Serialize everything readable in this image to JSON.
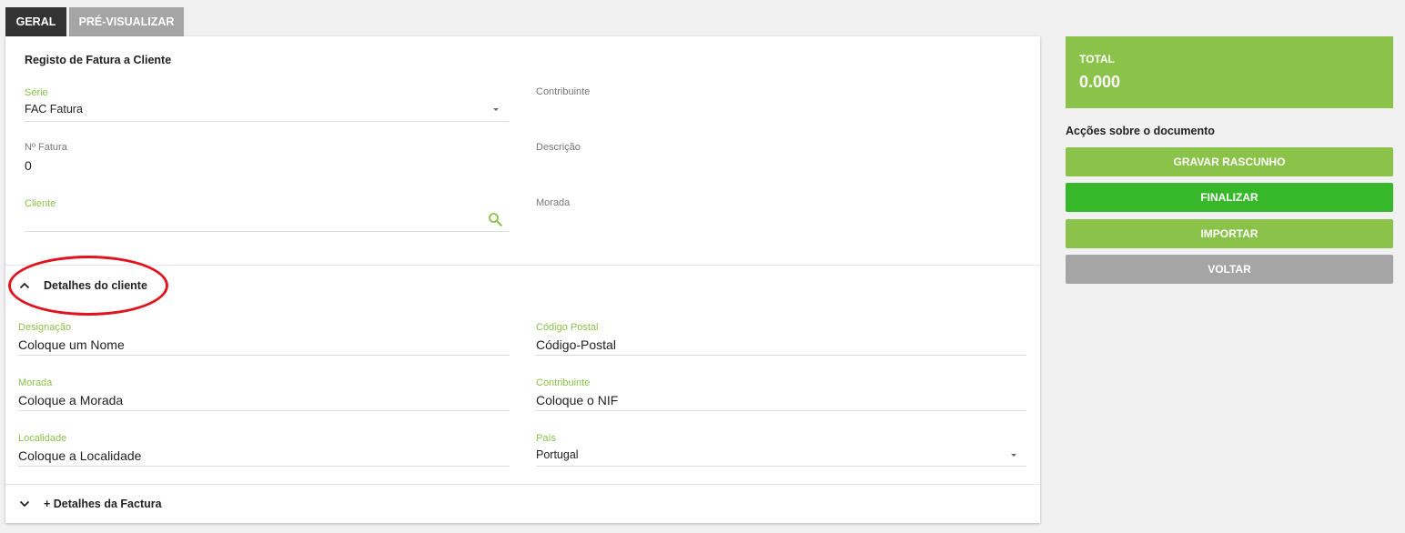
{
  "tabs": [
    {
      "label": "GERAL"
    },
    {
      "label": "PRÉ-VISUALIZAR"
    }
  ],
  "form": {
    "title": "Registo de Fatura a Cliente",
    "serie": {
      "label": "Série",
      "value": "FAC Fatura"
    },
    "contribuinte": {
      "label": "Contribuinte",
      "value": ""
    },
    "n_fatura": {
      "label": "Nº Fatura",
      "value": "0"
    },
    "descricao": {
      "label": "Descrição",
      "value": ""
    },
    "cliente": {
      "label": "Cliente",
      "value": ""
    },
    "morada": {
      "label": "Morada",
      "value": ""
    }
  },
  "client_details": {
    "title": "Detalhes do cliente",
    "designacao": {
      "label": "Designação",
      "placeholder": "Coloque um Nome"
    },
    "codigo_postal": {
      "label": "Código Postal",
      "placeholder": "Código-Postal"
    },
    "morada": {
      "label": "Morada",
      "placeholder": "Coloque a Morada"
    },
    "contribuinte": {
      "label": "Contribuinte",
      "placeholder": "Coloque o NIF"
    },
    "localidade": {
      "label": "Localidade",
      "placeholder": "Coloque a Localidade"
    },
    "pais": {
      "label": "País",
      "value": "Portugal"
    }
  },
  "invoice_details": {
    "title": "+ Detalhes da Factura"
  },
  "sidebar": {
    "total_label": "TOTAL",
    "total_value": "0.000",
    "actions_title": "Acções sobre o documento",
    "buttons": [
      {
        "label": "GRAVAR RASCUNHO",
        "color": "#8bc34a"
      },
      {
        "label": "FINALIZAR",
        "color": "#36b82a"
      },
      {
        "label": "IMPORTAR",
        "color": "#8bc34a"
      },
      {
        "label": "VOLTAR",
        "color": "#a5a5a5"
      }
    ]
  },
  "colors": {
    "accent": "#8bc34a",
    "highlight": "#e0141e"
  }
}
